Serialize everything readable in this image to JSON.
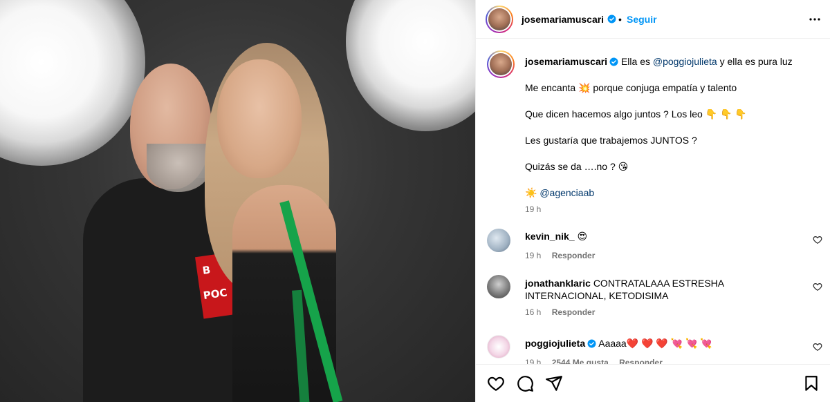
{
  "post": {
    "username": "josemariamuscari",
    "follow_label": "Seguir",
    "dot": "•"
  },
  "photo": {
    "shirt_print": [
      "B",
      "POC"
    ]
  },
  "caption": {
    "username": "josemariamuscari",
    "line1_before": "Ella es ",
    "line1_mention": "@poggiojulieta",
    "line1_after": " y ella es pura luz",
    "line2": "Me encanta 💥 porque conjuga empatía y talento",
    "line3": "Que dicen hacemos algo juntos ? Los leo 👇 👇 👇",
    "line4": "Les gustaría que trabajemos JUNTOS ?",
    "line5": "Quizás se da ….no ? 😘",
    "line6_emoji": "☀️",
    "line6_mention": "@agenciaab",
    "time": "19 h"
  },
  "comments": [
    {
      "username": "kevin_nik_",
      "text": "😍",
      "time": "19 h",
      "reply": "Responder",
      "likes": ""
    },
    {
      "username": "jonathanklaric",
      "text": "CONTRATALAAA ESTRESHA INTERNACIONAL, KETODISIMA",
      "time": "16 h",
      "reply": "Responder",
      "likes": ""
    },
    {
      "username": "poggiojulieta",
      "text": "Aaaaa❤️ ❤️ ❤️ 💘 💘 💘",
      "time": "19 h",
      "reply": "Responder",
      "likes": "2544 Me gusta"
    }
  ],
  "icons": {
    "more": "more-options-icon",
    "verified": "verified-badge-icon",
    "like": "heart-icon",
    "comment": "comment-icon",
    "share": "send-icon",
    "save": "bookmark-icon"
  },
  "colors": {
    "accent": "#0095f6",
    "mention": "#00376b",
    "muted": "#737373",
    "verified": "#0095f6"
  }
}
